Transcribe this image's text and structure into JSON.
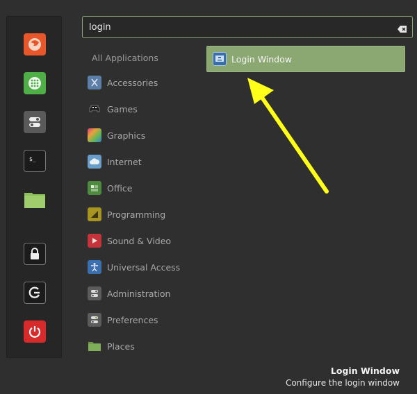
{
  "search": {
    "value": "login"
  },
  "categories": [
    {
      "label": "All Applications"
    },
    {
      "label": "Accessories",
      "icon": "accessories-icon"
    },
    {
      "label": "Games",
      "icon": "games-icon"
    },
    {
      "label": "Graphics",
      "icon": "graphics-icon"
    },
    {
      "label": "Internet",
      "icon": "internet-icon"
    },
    {
      "label": "Office",
      "icon": "office-icon"
    },
    {
      "label": "Programming",
      "icon": "programming-icon"
    },
    {
      "label": "Sound & Video",
      "icon": "sound-video-icon"
    },
    {
      "label": "Universal Access",
      "icon": "universal-access-icon"
    },
    {
      "label": "Administration",
      "icon": "administration-icon"
    },
    {
      "label": "Preferences",
      "icon": "preferences-icon"
    },
    {
      "label": "Places",
      "icon": "places-icon"
    }
  ],
  "results": [
    {
      "label": "Login Window",
      "icon": "login-window-icon"
    }
  ],
  "info": {
    "title": "Login Window",
    "description": "Configure the login window"
  },
  "favorites": [
    {
      "name": "firefox-icon",
      "color": "#e8572b"
    },
    {
      "name": "software-manager-icon",
      "color": "#4fae45"
    },
    {
      "name": "system-settings-icon",
      "color": "#5a5a5a"
    },
    {
      "name": "terminal-icon",
      "color": "#1b1b1b"
    },
    {
      "name": "files-icon",
      "color": "#8cbf5a"
    },
    {
      "name": "lock-screen-icon",
      "color": "#1b1b1b"
    },
    {
      "name": "logout-icon",
      "color": "#1b1b1b"
    },
    {
      "name": "shutdown-icon",
      "color": "#d72a2a"
    }
  ],
  "colors": {
    "accent": "#8ba873",
    "arrow": "#ffff1a"
  }
}
